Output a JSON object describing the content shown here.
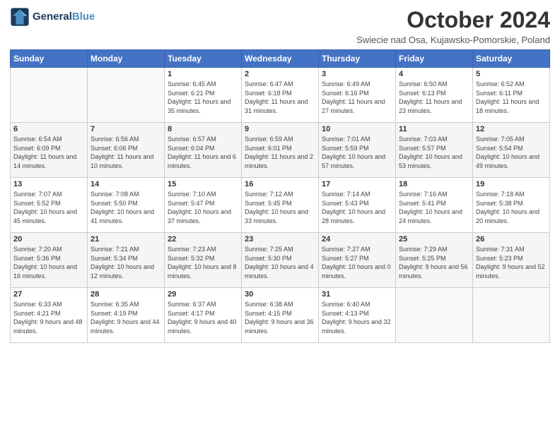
{
  "header": {
    "logo_line1": "General",
    "logo_line2": "Blue",
    "month_title": "October 2024",
    "subtitle": "Swiecie nad Osa, Kujawsko-Pomorskie, Poland"
  },
  "weekdays": [
    "Sunday",
    "Monday",
    "Tuesday",
    "Wednesday",
    "Thursday",
    "Friday",
    "Saturday"
  ],
  "weeks": [
    [
      {
        "day": "",
        "info": ""
      },
      {
        "day": "",
        "info": ""
      },
      {
        "day": "1",
        "info": "Sunrise: 6:45 AM\nSunset: 6:21 PM\nDaylight: 11 hours\nand 35 minutes."
      },
      {
        "day": "2",
        "info": "Sunrise: 6:47 AM\nSunset: 6:18 PM\nDaylight: 11 hours\nand 31 minutes."
      },
      {
        "day": "3",
        "info": "Sunrise: 6:49 AM\nSunset: 6:16 PM\nDaylight: 11 hours\nand 27 minutes."
      },
      {
        "day": "4",
        "info": "Sunrise: 6:50 AM\nSunset: 6:13 PM\nDaylight: 11 hours\nand 23 minutes."
      },
      {
        "day": "5",
        "info": "Sunrise: 6:52 AM\nSunset: 6:11 PM\nDaylight: 11 hours\nand 18 minutes."
      }
    ],
    [
      {
        "day": "6",
        "info": "Sunrise: 6:54 AM\nSunset: 6:09 PM\nDaylight: 11 hours\nand 14 minutes."
      },
      {
        "day": "7",
        "info": "Sunrise: 6:56 AM\nSunset: 6:06 PM\nDaylight: 11 hours\nand 10 minutes."
      },
      {
        "day": "8",
        "info": "Sunrise: 6:57 AM\nSunset: 6:04 PM\nDaylight: 11 hours\nand 6 minutes."
      },
      {
        "day": "9",
        "info": "Sunrise: 6:59 AM\nSunset: 6:01 PM\nDaylight: 11 hours\nand 2 minutes."
      },
      {
        "day": "10",
        "info": "Sunrise: 7:01 AM\nSunset: 5:59 PM\nDaylight: 10 hours\nand 57 minutes."
      },
      {
        "day": "11",
        "info": "Sunrise: 7:03 AM\nSunset: 5:57 PM\nDaylight: 10 hours\nand 53 minutes."
      },
      {
        "day": "12",
        "info": "Sunrise: 7:05 AM\nSunset: 5:54 PM\nDaylight: 10 hours\nand 49 minutes."
      }
    ],
    [
      {
        "day": "13",
        "info": "Sunrise: 7:07 AM\nSunset: 5:52 PM\nDaylight: 10 hours\nand 45 minutes."
      },
      {
        "day": "14",
        "info": "Sunrise: 7:08 AM\nSunset: 5:50 PM\nDaylight: 10 hours\nand 41 minutes."
      },
      {
        "day": "15",
        "info": "Sunrise: 7:10 AM\nSunset: 5:47 PM\nDaylight: 10 hours\nand 37 minutes."
      },
      {
        "day": "16",
        "info": "Sunrise: 7:12 AM\nSunset: 5:45 PM\nDaylight: 10 hours\nand 33 minutes."
      },
      {
        "day": "17",
        "info": "Sunrise: 7:14 AM\nSunset: 5:43 PM\nDaylight: 10 hours\nand 28 minutes."
      },
      {
        "day": "18",
        "info": "Sunrise: 7:16 AM\nSunset: 5:41 PM\nDaylight: 10 hours\nand 24 minutes."
      },
      {
        "day": "19",
        "info": "Sunrise: 7:18 AM\nSunset: 5:38 PM\nDaylight: 10 hours\nand 20 minutes."
      }
    ],
    [
      {
        "day": "20",
        "info": "Sunrise: 7:20 AM\nSunset: 5:36 PM\nDaylight: 10 hours\nand 16 minutes."
      },
      {
        "day": "21",
        "info": "Sunrise: 7:21 AM\nSunset: 5:34 PM\nDaylight: 10 hours\nand 12 minutes."
      },
      {
        "day": "22",
        "info": "Sunrise: 7:23 AM\nSunset: 5:32 PM\nDaylight: 10 hours\nand 8 minutes."
      },
      {
        "day": "23",
        "info": "Sunrise: 7:25 AM\nSunset: 5:30 PM\nDaylight: 10 hours\nand 4 minutes."
      },
      {
        "day": "24",
        "info": "Sunrise: 7:27 AM\nSunset: 5:27 PM\nDaylight: 10 hours\nand 0 minutes."
      },
      {
        "day": "25",
        "info": "Sunrise: 7:29 AM\nSunset: 5:25 PM\nDaylight: 9 hours\nand 56 minutes."
      },
      {
        "day": "26",
        "info": "Sunrise: 7:31 AM\nSunset: 5:23 PM\nDaylight: 9 hours\nand 52 minutes."
      }
    ],
    [
      {
        "day": "27",
        "info": "Sunrise: 6:33 AM\nSunset: 4:21 PM\nDaylight: 9 hours\nand 48 minutes."
      },
      {
        "day": "28",
        "info": "Sunrise: 6:35 AM\nSunset: 4:19 PM\nDaylight: 9 hours\nand 44 minutes."
      },
      {
        "day": "29",
        "info": "Sunrise: 6:37 AM\nSunset: 4:17 PM\nDaylight: 9 hours\nand 40 minutes."
      },
      {
        "day": "30",
        "info": "Sunrise: 6:38 AM\nSunset: 4:15 PM\nDaylight: 9 hours\nand 36 minutes."
      },
      {
        "day": "31",
        "info": "Sunrise: 6:40 AM\nSunset: 4:13 PM\nDaylight: 9 hours\nand 32 minutes."
      },
      {
        "day": "",
        "info": ""
      },
      {
        "day": "",
        "info": ""
      }
    ]
  ]
}
